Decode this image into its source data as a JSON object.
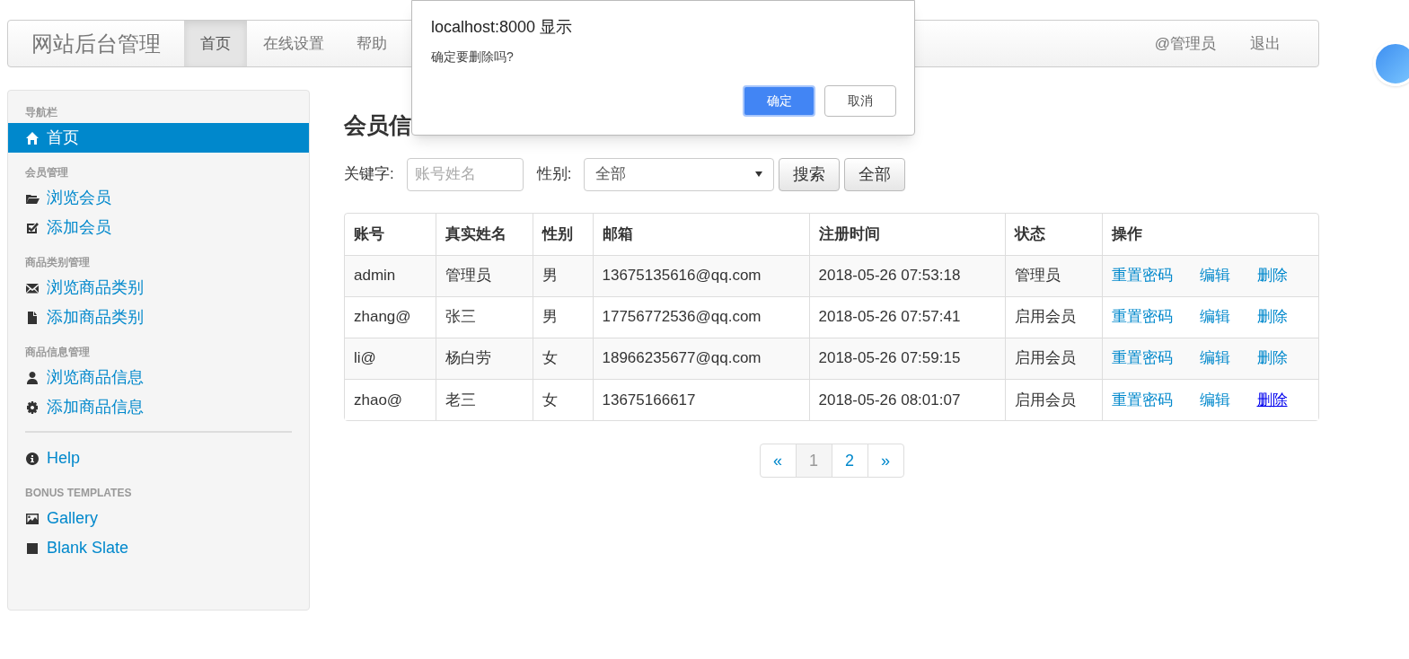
{
  "navbar": {
    "brand": "网站后台管理",
    "tabs": [
      {
        "label": "首页",
        "selected": true
      },
      {
        "label": "在线设置",
        "selected": false
      },
      {
        "label": "帮助",
        "selected": false
      }
    ],
    "right": [
      "@管理员",
      "退出"
    ]
  },
  "sidebar": {
    "sections": [
      {
        "header": "导航栏",
        "items": [
          {
            "kind": "home",
            "label": "首页",
            "selected": true
          }
        ]
      },
      {
        "header": "会员管理",
        "items": [
          {
            "kind": "folder",
            "label": "浏览会员",
            "selected": false
          },
          {
            "kind": "check",
            "label": "添加会员",
            "selected": false
          }
        ]
      },
      {
        "header": "商品类别管理",
        "items": [
          {
            "kind": "envelope",
            "label": "浏览商品类别",
            "selected": false
          },
          {
            "kind": "file",
            "label": "添加商品类别",
            "selected": false
          }
        ]
      },
      {
        "header": "商品信息管理",
        "items": [
          {
            "kind": "user",
            "label": "浏览商品信息",
            "selected": false
          },
          {
            "kind": "gear",
            "label": "添加商品信息",
            "selected": false
          }
        ]
      },
      {
        "divider": true,
        "items": [
          {
            "kind": "info",
            "label": "Help",
            "selected": false
          }
        ]
      },
      {
        "header": "BONUS TEMPLATES",
        "items": [
          {
            "kind": "picture",
            "label": "Gallery",
            "selected": false
          },
          {
            "kind": "square",
            "label": "Blank Slate",
            "selected": false
          }
        ]
      }
    ]
  },
  "main": {
    "heading": "会员信",
    "search": {
      "keyword_label": "关键字:",
      "placeholder": "账号姓名",
      "gender_label": "性别:",
      "gender_value": "全部",
      "buttons": [
        "搜索",
        "全部"
      ]
    },
    "table": {
      "columns": [
        "账号",
        "真实姓名",
        "性别",
        "邮箱",
        "注册时间",
        "状态",
        "操作"
      ],
      "rows": [
        {
          "cells": [
            "admin",
            "管理员",
            "男",
            "13675135616@qq.com",
            "2018-05-26 07:53:18",
            "管理员"
          ],
          "actions": [
            {
              "label": "重置密码",
              "hovered": false
            },
            {
              "label": "编辑",
              "hovered": false
            },
            {
              "label": "删除",
              "hovered": false
            }
          ]
        },
        {
          "cells": [
            "zhang@",
            "张三",
            "男",
            "17756772536@qq.com",
            "2018-05-26 07:57:41",
            "启用会员"
          ],
          "actions": [
            {
              "label": "重置密码",
              "hovered": false
            },
            {
              "label": "编辑",
              "hovered": false
            },
            {
              "label": "删除",
              "hovered": false
            }
          ]
        },
        {
          "cells": [
            "li@",
            "杨白劳",
            "女",
            "18966235677@qq.com",
            "2018-05-26 07:59:15",
            "启用会员"
          ],
          "actions": [
            {
              "label": "重置密码",
              "hovered": false
            },
            {
              "label": "编辑",
              "hovered": false
            },
            {
              "label": "删除",
              "hovered": false
            }
          ]
        },
        {
          "cells": [
            "zhao@",
            "老三",
            "女",
            "13675166617",
            "2018-05-26 08:01:07",
            "启用会员"
          ],
          "actions": [
            {
              "label": "重置密码",
              "hovered": false
            },
            {
              "label": "编辑",
              "hovered": false
            },
            {
              "label": "删除",
              "hovered": true
            }
          ]
        }
      ]
    },
    "pagination": [
      {
        "label": "«",
        "selected": false
      },
      {
        "label": "1",
        "selected": true
      },
      {
        "label": "2",
        "selected": false
      },
      {
        "label": "»",
        "selected": false
      }
    ]
  },
  "dialog": {
    "title": "localhost:8000 显示",
    "message": "确定要删除吗?",
    "buttons": [
      {
        "label": "确定",
        "primary": true
      },
      {
        "label": "取消",
        "primary": false
      }
    ]
  }
}
